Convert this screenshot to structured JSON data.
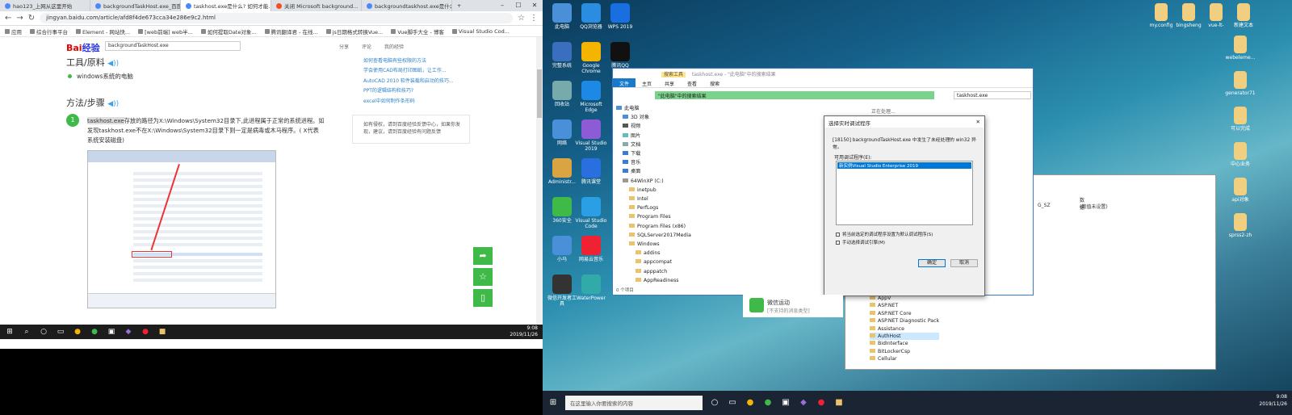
{
  "browser": {
    "tabs": [
      {
        "label": "hao123_上网从这里开始"
      },
      {
        "label": "backgroundTaskHost.exe_百度"
      },
      {
        "label": "taskhost.exe是什么? 如何才能..."
      },
      {
        "label": "关闭 Microsoft background..."
      },
      {
        "label": "backgroundtaskhost.exe是什么..."
      }
    ],
    "url": "jingyan.baidu.com/article/afd8f4de673cca34e286e9c2.html",
    "bookmarks": [
      "应用",
      "综合行事平台",
      "Element - 网站快...",
      "[web前端] web半...",
      "如何提取Date对象...",
      "腾讯翻译君 - 在线...",
      "js日期格式转换Vue...",
      "Vue脚手大全 - 博客",
      "Visual Studio Cod..."
    ],
    "win_controls": [
      "–",
      "☐",
      "✕"
    ]
  },
  "article": {
    "logo": "Bai",
    "logo_suffix": "经验",
    "search_value": "backgroundTaskHost.exe",
    "header_links": [
      "分享",
      "评论",
      "我的经验"
    ],
    "tools_heading": "工具/原料",
    "tool_item": "windows系统的电脑",
    "steps_heading": "方法/步骤",
    "step_num": "1",
    "step_hl": "taskhost.exe",
    "step_text": "存放的路径为X:\\Windows\\System32目录下,此进程属于正常的系统进程。如发现taskhost.exe不在X:\\Windows\\System32目录下则一定是病毒或木马程序。( X代表系统安装磁盘)",
    "side_links": [
      "如何查看电脑有些权限的方法",
      "学会使用CAD布局打印图纸，让工作...",
      "AutoCAD 2010 软件装载和启动的技巧...",
      "PPT的逻辑结构和技巧?",
      "excel中如何制作条形码"
    ],
    "side_note": "如有侵权，请到百度经验反馈中心，如果你发现，建议，请到百度经验有问题反馈"
  },
  "left_clock": {
    "time": "9:08",
    "date": "2019/11/26"
  },
  "desktop": {
    "icons_col1": [
      "此电脑",
      "完整系统",
      "回收站",
      "网络",
      "Administr...",
      "360安全",
      "小马",
      "微信开发者工具"
    ],
    "icons_col2": [
      "QQ浏览器",
      "Google Chrome",
      "Microsoft Edge",
      "Visual Studio 2019",
      "腾讯课堂",
      "Visual Studio Code",
      "网易云音乐",
      "WaterPower"
    ],
    "icons_col3": [
      "WPS 2019",
      "腾讯QQ",
      "",
      "",
      "",
      "",
      "",
      ""
    ],
    "right_icons": [
      "my.config",
      "bingsheng",
      "vue-lt-",
      "新建文本",
      "webeleme...",
      "generator71",
      "可以完成",
      "中心业务",
      "api对象",
      "sprss2-zh"
    ]
  },
  "explorer": {
    "title": "taskhost.exe - \"此电脑\"中的搜索结果",
    "search_tools": "搜索工具",
    "ribbon": [
      "文件",
      "主页",
      "共享",
      "查看",
      "搜索"
    ],
    "path": "\"此电脑\"中的搜索结果",
    "search_value": "taskhost.exe",
    "searching": "正在处理...",
    "tree": [
      "此电脑",
      "3D 对象",
      "视频",
      "图片",
      "文档",
      "下载",
      "音乐",
      "桌面",
      "64WinXP (C:)",
      "inetpub",
      "Intel",
      "PerfLogs",
      "Program Files",
      "Program Files (x86)",
      "SQLServer2017Media",
      "Windows",
      "addins",
      "appcompat",
      "apppatch",
      "AppReadiness"
    ],
    "status": "0 个项目"
  },
  "dialog": {
    "title": "选择实时调试程序",
    "message": "[18150] backgroundTaskHost.exe 中发生了未经处理的 win32 异常。",
    "list_label": "可用调试程序(E):",
    "list_item": "新实例Visual Studio Enterprise 2019",
    "check1": "将当前选定的调试程序设置为默认调试程序(S)",
    "check2": "手动选择调试引擎(M)",
    "ok": "确定",
    "cancel": "取消"
  },
  "backwin": {
    "col_name": "G_SZ",
    "col_data_hdr": "数据",
    "col_data": "(数值未设置)",
    "reg_tree": [
      "AppV",
      "ASP.NET",
      "ASP.NET Core",
      "ASP.NET Diagnostic Pack",
      "Assistance",
      "AuthHost",
      "BidInterface",
      "BitLockerCsp",
      "Cellular"
    ]
  },
  "wechat": {
    "title": "微信运动",
    "sub": "[不支持的消息类型]"
  },
  "right_taskbar": {
    "search": "在这里输入你要搜索的内容",
    "time": "9:08",
    "date": "2019/11/26"
  }
}
